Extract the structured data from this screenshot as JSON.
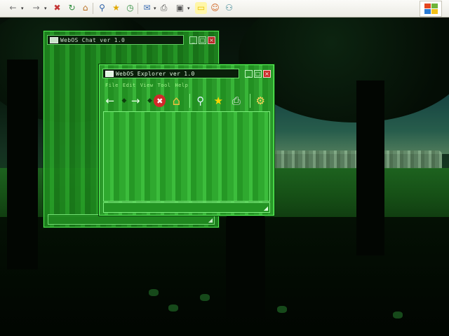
{
  "browser_toolbar": {
    "buttons": [
      {
        "name": "back",
        "glyph": "←"
      },
      {
        "name": "forward",
        "glyph": "→"
      },
      {
        "name": "stop",
        "glyph": "✖"
      },
      {
        "name": "refresh",
        "glyph": "↻"
      },
      {
        "name": "home",
        "glyph": "⌂"
      },
      {
        "name": "search",
        "glyph": "⚲"
      },
      {
        "name": "favorites",
        "glyph": "★"
      },
      {
        "name": "history",
        "glyph": "◷"
      },
      {
        "name": "mail",
        "glyph": "✉"
      },
      {
        "name": "print",
        "glyph": "⎙"
      },
      {
        "name": "edit",
        "glyph": "▣"
      },
      {
        "name": "notes",
        "glyph": "▭"
      },
      {
        "name": "messenger",
        "glyph": "☺"
      },
      {
        "name": "contacts",
        "glyph": "⚇"
      }
    ]
  },
  "windows": {
    "chat": {
      "title": "WebOS Chat ver 1.0",
      "minimize": "_",
      "maximize": "□",
      "close": "×"
    },
    "explorer": {
      "title": "WebOS Explorer ver 1.0",
      "minimize": "_",
      "maximize": "□",
      "close": "×",
      "menu": [
        "File",
        "Edit",
        "View",
        "Tool",
        "Help"
      ],
      "toolbar_icons": [
        "←",
        "→",
        "✖",
        "⌂",
        "⚲",
        "★",
        "⎙",
        "⚙"
      ]
    }
  },
  "colors": {
    "window_border": "#5cff5c",
    "window_fill": "#2a9a2a",
    "close_red": "#cc2a2a"
  }
}
